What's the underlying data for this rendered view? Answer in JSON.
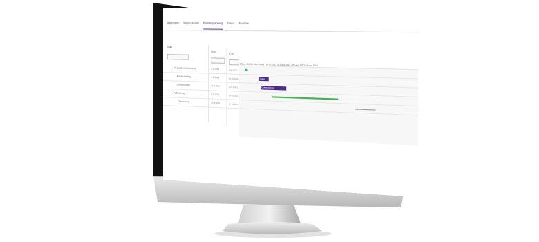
{
  "screen": {
    "menu": [
      "Algemeen",
      "Beginsituatie",
      "Ruimteplanning",
      "Taken",
      "Analyse"
    ],
    "active_menu_index": 2,
    "tree_header": "Taak",
    "col_start": "Start",
    "col_end": "Eind",
    "gantt_caption": "30 jun 2021 | 14 jul 2021 | 28 jul 2021 | 11 aug 2021 | 25 aug 2021 | 8 sep 2021",
    "rows": [
      {
        "label": "▸ Projectvoorbereiding",
        "start": "1-6-2021",
        "end": "4-6-2021"
      },
      {
        "label": "Aanbesteding",
        "start": "7-6-2021",
        "end": "18-6-2021"
      },
      {
        "label": "Ontwerpfase",
        "start": "21-6-2021",
        "end": "2-7-2021"
      },
      {
        "label": "▸ Uitvoering",
        "start": "5-7-2021",
        "end": "10-9-2021"
      },
      {
        "label": "Oplevering",
        "start": "13-9-2021",
        "end": "17-9-2021"
      }
    ],
    "bars": [
      {
        "label": "Fase",
        "start": 0.13,
        "end": 0.2,
        "color": "#4b2a8f"
      },
      {
        "label": "Ontwerpfase",
        "start": 0.12,
        "end": 0.3,
        "color": "#4b2a8f"
      }
    ]
  },
  "colors": {
    "accent": "#4b2a8f",
    "progress": "#3db54a",
    "monitor_silver": "#c8c8c8",
    "bezel": "#111111"
  }
}
